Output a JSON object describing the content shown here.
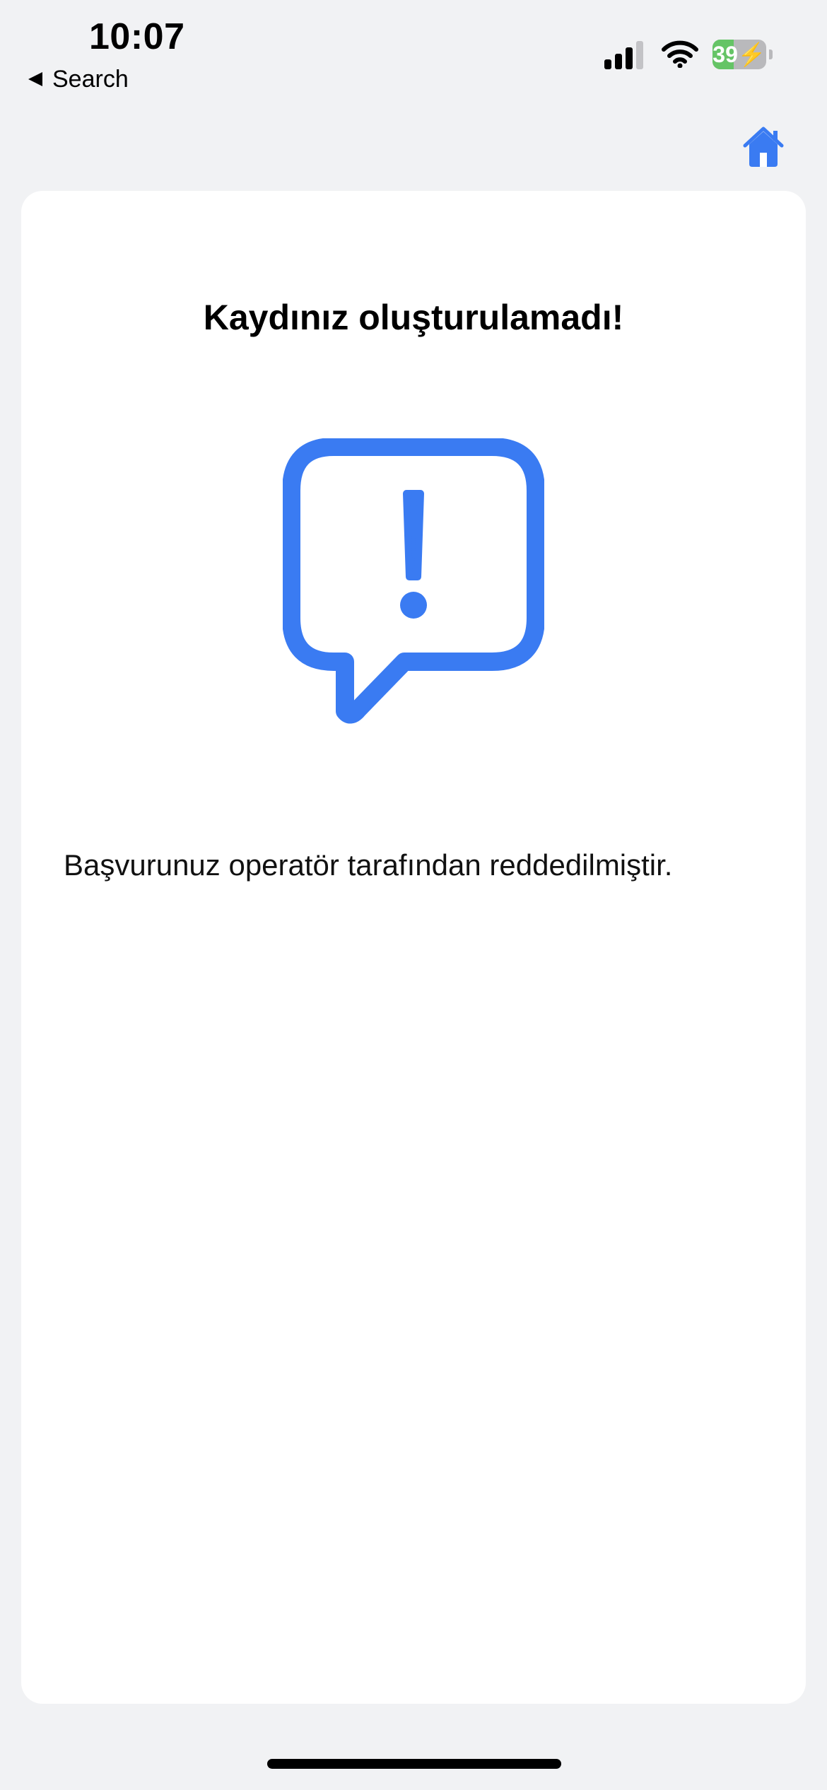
{
  "status_bar": {
    "time": "10:07",
    "back_label": "Search",
    "battery_percent": "39",
    "battery_level": 0.39,
    "battery_charging": true,
    "icons": [
      "back-arrow-icon",
      "cellular-signal-icon",
      "wifi-icon",
      "battery-icon"
    ]
  },
  "header": {
    "home_icon": "home-icon"
  },
  "content": {
    "title": "Kaydınız oluşturulamadı!",
    "message": "Başvurunuz operatör tarafından reddedilmiştir.",
    "alert_icon": "exclamation-speech-bubble-icon"
  },
  "colors": {
    "accent": "#3a7bf2",
    "background": "#f1f2f4",
    "card": "#ffffff",
    "battery_fill": "#65c466"
  }
}
